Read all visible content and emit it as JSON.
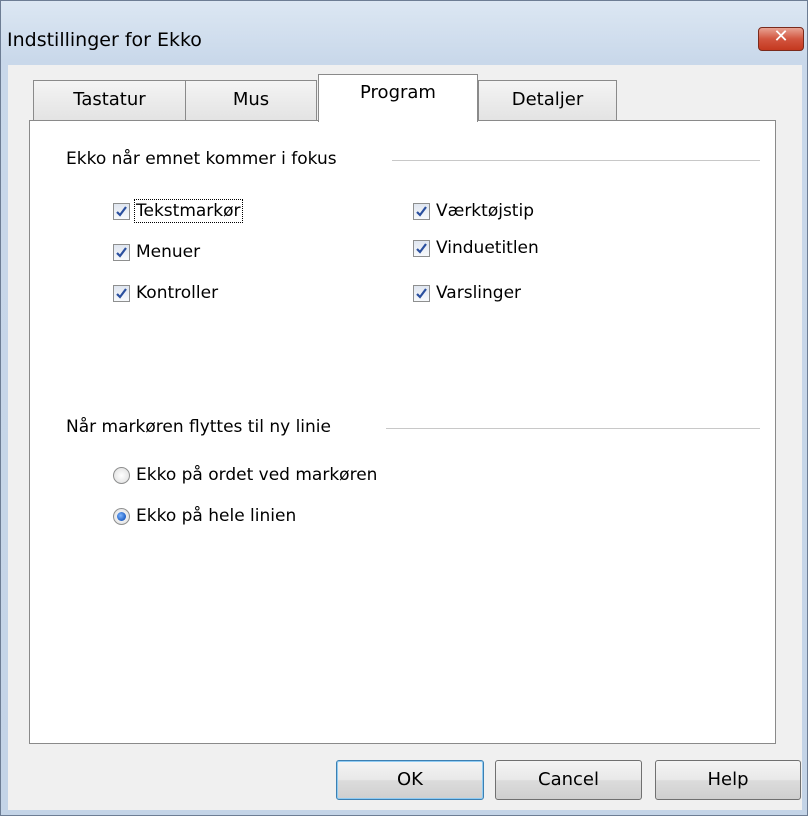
{
  "window": {
    "title": "Indstillinger for Ekko",
    "close_glyph": "✕"
  },
  "tabs": [
    {
      "label": "Tastatur",
      "active": false
    },
    {
      "label": "Mus",
      "active": false
    },
    {
      "label": "Program",
      "active": true
    },
    {
      "label": "Detaljer",
      "active": false
    }
  ],
  "focus_group": {
    "label": "Ekko når emnet kommer i fokus",
    "checkboxes": [
      {
        "label": "Tekstmarkør",
        "checked": true,
        "focused": true
      },
      {
        "label": "Menuer",
        "checked": true
      },
      {
        "label": "Kontroller",
        "checked": true
      },
      {
        "label": "Værktøjstip",
        "checked": true
      },
      {
        "label": "Vinduetitlen",
        "checked": true
      },
      {
        "label": "Varslinger",
        "checked": true
      }
    ]
  },
  "line_group": {
    "label": "Når markøren flyttes til ny linie",
    "radios": [
      {
        "label": "Ekko på ordet ved markøren",
        "selected": false
      },
      {
        "label": "Ekko på hele linien",
        "selected": true
      }
    ]
  },
  "buttons": {
    "ok": "OK",
    "cancel": "Cancel",
    "help": "Help"
  },
  "colors": {
    "check": "#2a4f9e",
    "accent": "#3c7fb1",
    "close": "#c4381f"
  }
}
